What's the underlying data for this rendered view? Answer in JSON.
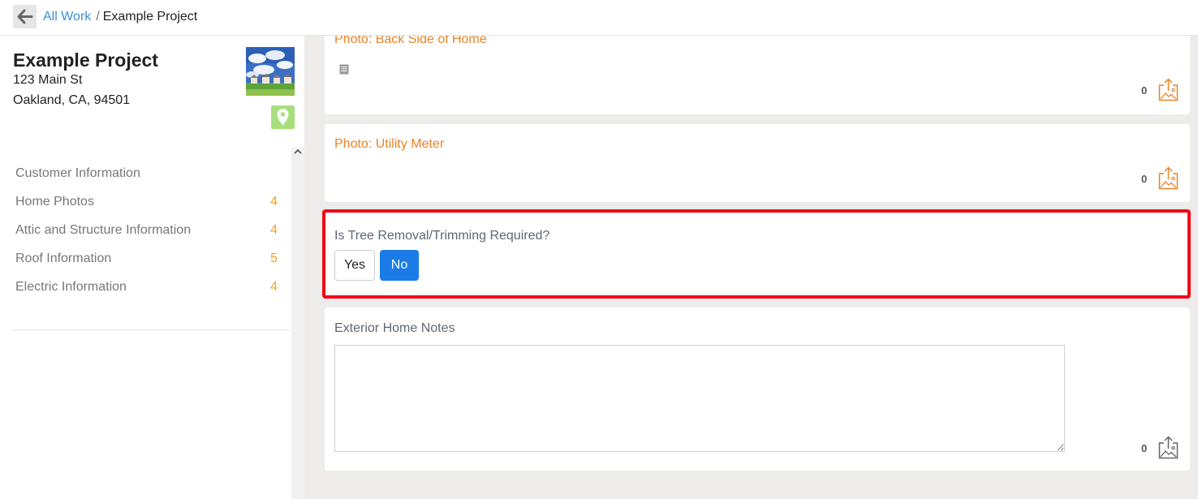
{
  "breadcrumb": {
    "back_label": "",
    "parent": "All Work",
    "separator": "/",
    "current": "Example Project"
  },
  "project": {
    "name": "Example Project",
    "address_line1": "123 Main St",
    "address_line2": "Oakland, CA, 94501"
  },
  "sidebar": {
    "items": [
      {
        "label": "Customer Information",
        "count": ""
      },
      {
        "label": "Home Photos",
        "count": "4"
      },
      {
        "label": "Attic and Structure Information",
        "count": "4"
      },
      {
        "label": "Roof Information",
        "count": "5"
      },
      {
        "label": "Electric Information",
        "count": "4"
      }
    ]
  },
  "main": {
    "card1": {
      "title": "Photo: Back Side of Home",
      "upload_count": "0"
    },
    "card2": {
      "title": "Photo: Utility Meter",
      "upload_count": "0"
    },
    "question": {
      "text": "Is Tree Removal/Trimming Required?",
      "yes_label": "Yes",
      "no_label": "No",
      "selected": "No"
    },
    "notes": {
      "label": "Exterior Home Notes",
      "value": "",
      "upload_count": "0"
    }
  },
  "colors": {
    "link": "#3b8fd9",
    "count_accent": "#f3a21b",
    "photo_title": "#e88326",
    "selected_button": "#1b7ce8",
    "highlight_border": "#ef0a16",
    "map_button": "#a8df7d"
  },
  "icons": [
    "arrow-left-icon",
    "map-pin-icon",
    "chevron-up-icon",
    "note-icon",
    "image-upload-icon"
  ]
}
